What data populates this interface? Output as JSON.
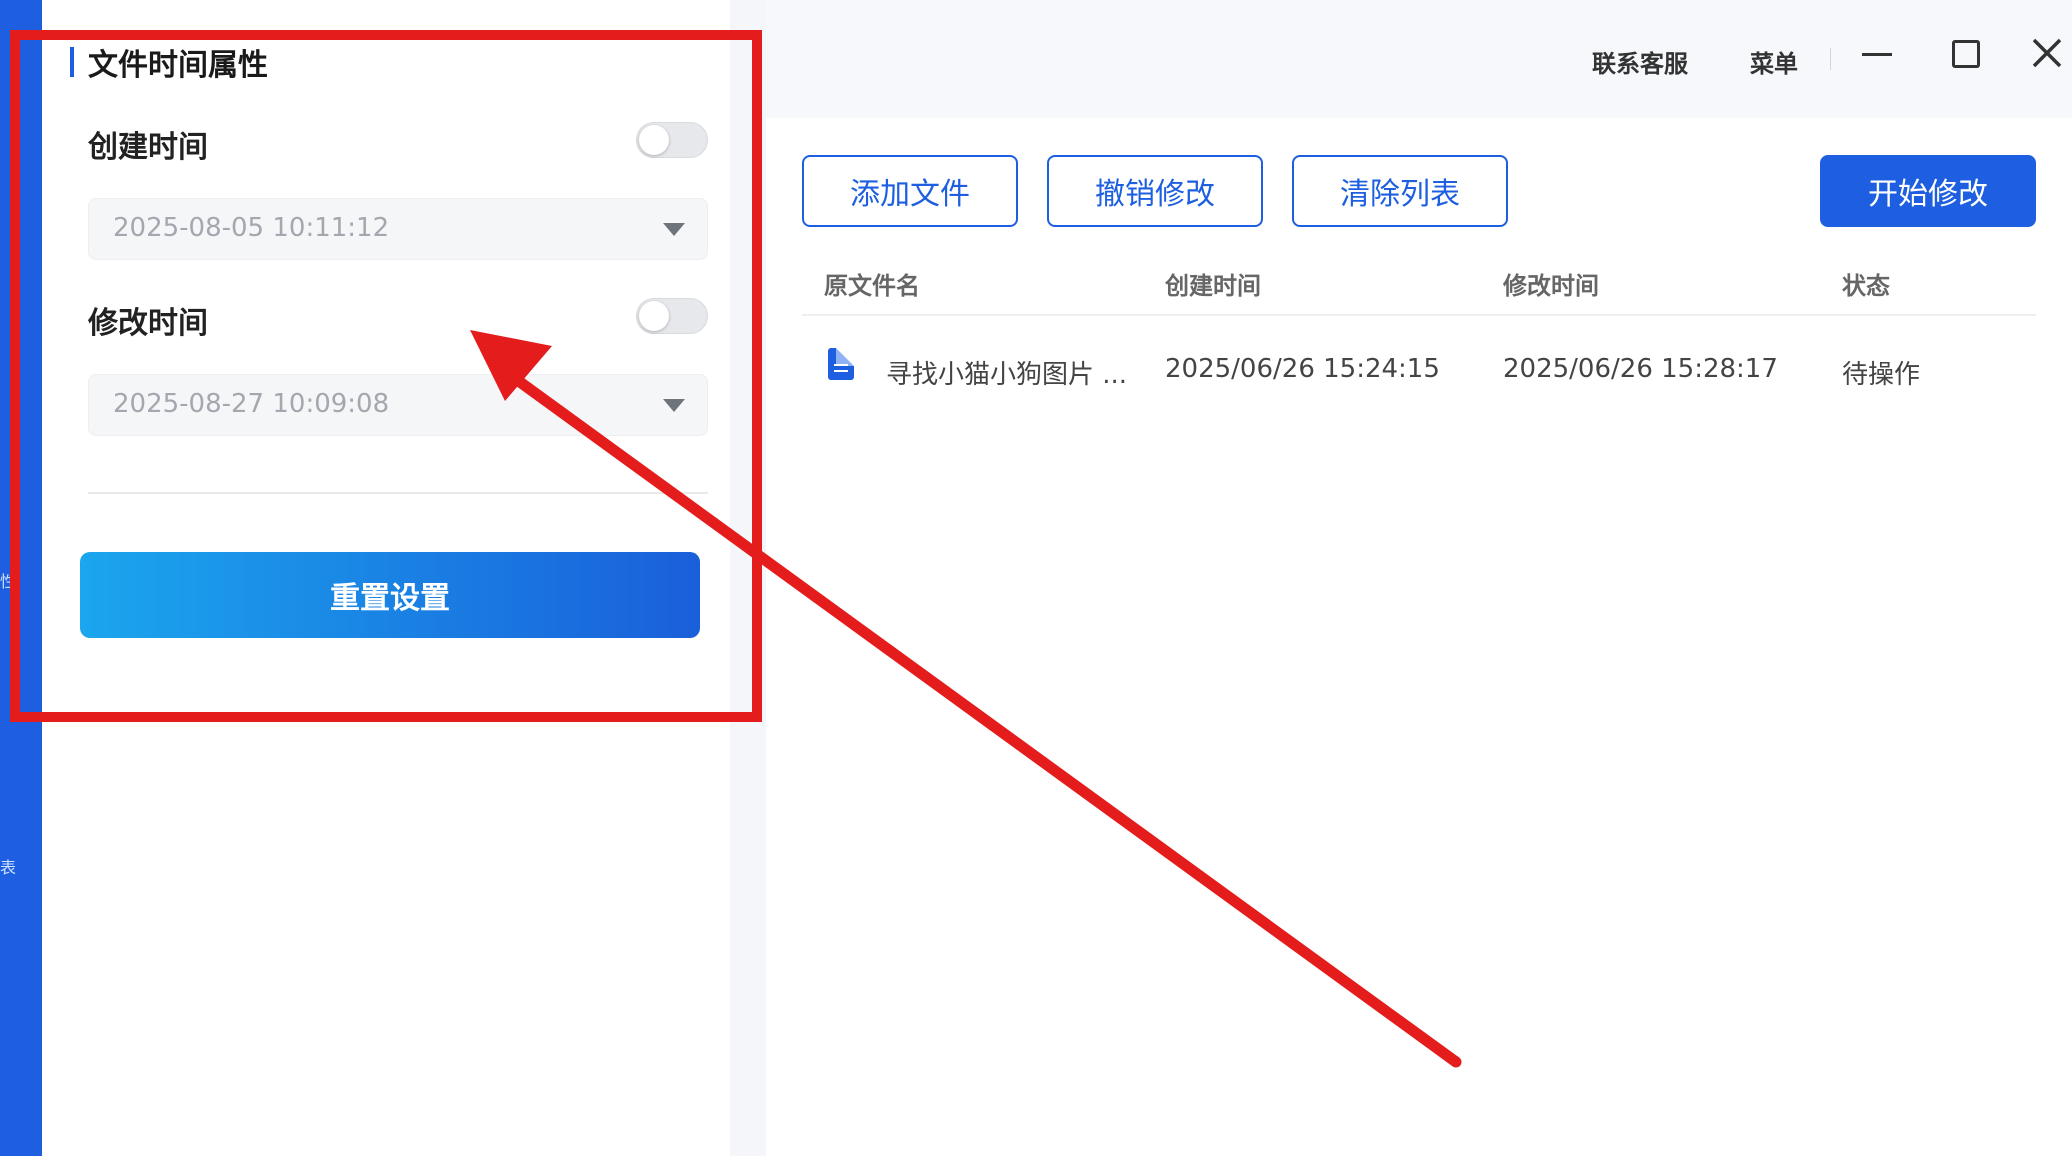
{
  "left_panel": {
    "section_title": "文件时间属性",
    "created": {
      "label": "创建时间",
      "enabled": false,
      "value": "2025-08-05 10:11:12"
    },
    "modified": {
      "label": "修改时间",
      "enabled": false,
      "value": "2025-08-27 10:09:08"
    },
    "reset_label": "重置设置"
  },
  "rail": {
    "glyph_1": "性",
    "glyph_2": "表"
  },
  "titlebar": {
    "support": "联系客服",
    "menu": "菜单"
  },
  "toolbar": {
    "add": "添加文件",
    "undo": "撤销修改",
    "clear": "清除列表",
    "start": "开始修改"
  },
  "table": {
    "headers": {
      "name": "原文件名",
      "created": "创建时间",
      "modified": "修改时间",
      "status": "状态"
    },
    "rows": [
      {
        "name": "寻找小猫小狗图片 ...",
        "created": "2025/06/26 15:24:15",
        "modified": "2025/06/26 15:28:17",
        "status": "待操作"
      }
    ]
  },
  "colors": {
    "accent": "#1d5fe0",
    "annotation": "#e41c1c"
  },
  "icons": {
    "document": "document-icon",
    "arrow": "annotation-arrow"
  }
}
